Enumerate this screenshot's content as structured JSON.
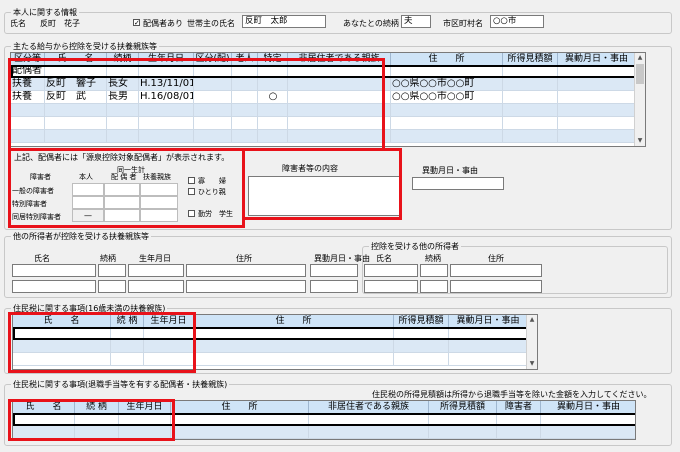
{
  "personal": {
    "section_title": "本人に関する情報",
    "name_label": "氏名",
    "name_value": "反町　花子",
    "spouse_checkbox_label": "配偶者あり",
    "spouse_checked": true,
    "household_head_label": "世帯主の氏名",
    "household_head_value": "反町　太郎",
    "relation_label": "あなたとの続柄",
    "relation_value": "夫",
    "city_label": "市区町村名",
    "city_value": "○○市"
  },
  "dependents": {
    "section_title": "主たる給与から控除を受ける扶養親族等",
    "columns": [
      "区分等",
      "氏　　名",
      "続柄",
      "生年月日",
      "区分(配)",
      "老人",
      "特定",
      "非居住者である親族",
      "住　　所",
      "所得見積額",
      "異動月日・事由"
    ],
    "rows": [
      {
        "kubun": "配偶者",
        "name": "",
        "relation": "",
        "birth": "",
        "haikubun": "",
        "rojin": "",
        "tokutei": "",
        "nonresident": "",
        "address": "",
        "income": "",
        "change": ""
      },
      {
        "kubun": "扶養",
        "name": "反町　響子",
        "relation": "長女",
        "birth": "H.13/11/01",
        "haikubun": "",
        "rojin": "",
        "tokutei": "",
        "nonresident": "",
        "address": "○○県○○市○○町",
        "income": "",
        "change": ""
      },
      {
        "kubun": "扶養",
        "name": "反町　武",
        "relation": "長男",
        "birth": "H.16/08/01",
        "haikubun": "",
        "rojin": "",
        "tokutei": "○",
        "nonresident": "",
        "address": "○○県○○市○○町",
        "income": "",
        "change": ""
      },
      {
        "kubun": "",
        "name": "",
        "relation": "",
        "birth": "",
        "haikubun": "",
        "rojin": "",
        "tokutei": "",
        "nonresident": "",
        "address": "",
        "income": "",
        "change": ""
      },
      {
        "kubun": "",
        "name": "",
        "relation": "",
        "birth": "",
        "haikubun": "",
        "rojin": "",
        "tokutei": "",
        "nonresident": "",
        "address": "",
        "income": "",
        "change": ""
      },
      {
        "kubun": "",
        "name": "",
        "relation": "",
        "birth": "",
        "haikubun": "",
        "rojin": "",
        "tokutei": "",
        "nonresident": "",
        "address": "",
        "income": "",
        "change": ""
      }
    ],
    "note": "上記、配偶者には「源泉控除対象配偶者」が表示されます。"
  },
  "disability": {
    "header_label": "障害者",
    "col_self": "本人",
    "col_same_household_top": "同一生計",
    "col_same_household_bottom": "配 偶 者",
    "col_dependents": "扶養親族",
    "row_general": "一般の障害者",
    "row_special": "特別障害者",
    "row_cohabit": "同居特別障害者",
    "cohabit_self_value": "—",
    "check_widow_label": "寡　　婦",
    "check_single_parent_label": "ひとり親",
    "check_student_label": "勤労　学生",
    "detail_label": "障害者等の内容",
    "change_label": "異動月日・事由"
  },
  "other_income": {
    "section_title": "他の所得者が控除を受ける扶養親族等",
    "cols": [
      "氏名",
      "続柄",
      "生年月日",
      "住所",
      "異動月日・事由"
    ],
    "sub_title": "控除を受ける他の所得者",
    "sub_cols": [
      "氏名",
      "続柄",
      "住所"
    ]
  },
  "resident_tax": {
    "section_title": "住民税に関する事項(16歳未満の扶養親族)",
    "columns": [
      "氏　　名",
      "続 柄",
      "生年月日",
      "住　　所",
      "所得見積額",
      "異動月日・事由"
    ]
  },
  "resident_tax_retire": {
    "section_title": "住民税に関する事項(退職手当等を有する配偶者・扶養親族)",
    "note": "住民税の所得見積額は所得から退職手当等を除いた金額を入力してください。",
    "columns": [
      "氏　　名",
      "続 柄",
      "生年月日",
      "住　　所",
      "非居住者である親族",
      "所得見積額",
      "障害者",
      "異動月日・事由"
    ]
  }
}
